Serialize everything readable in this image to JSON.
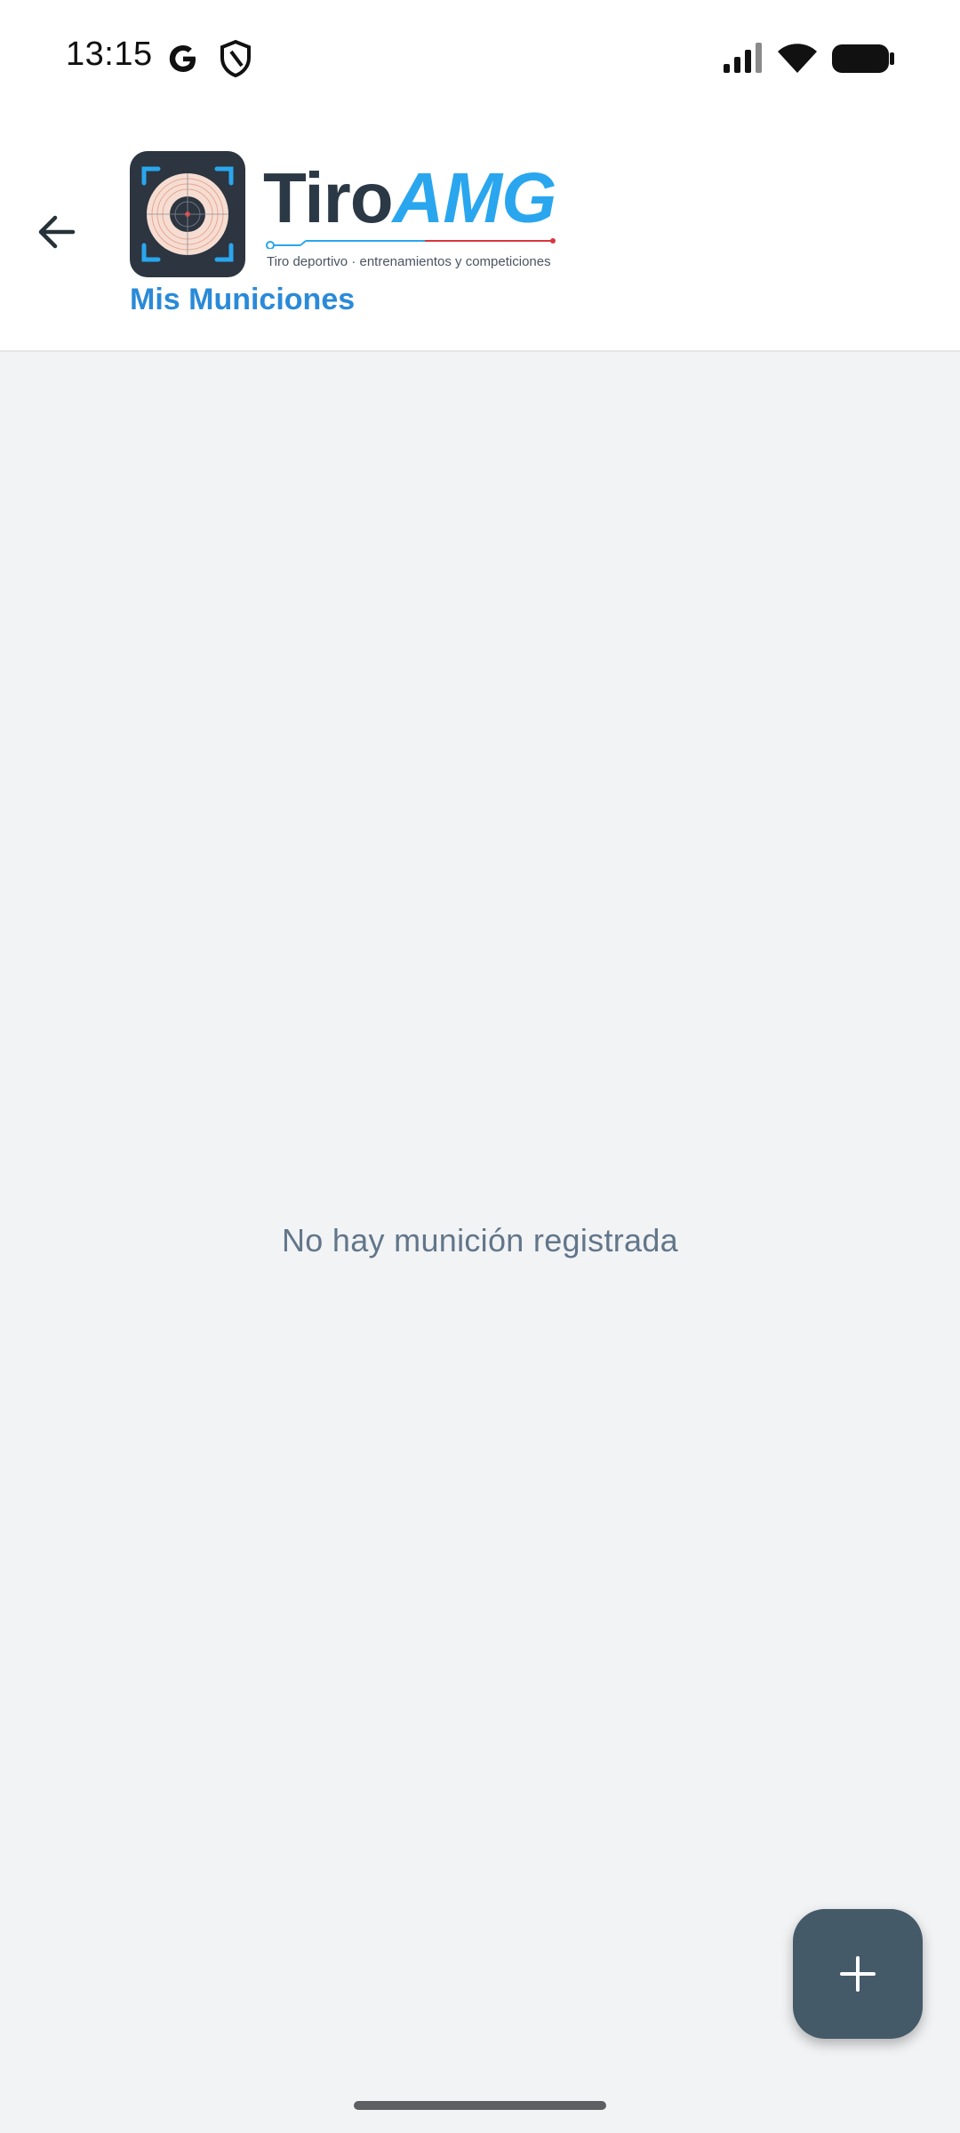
{
  "status_bar": {
    "time": "13:15",
    "icons": [
      "google-icon",
      "shield-icon",
      "signal-icon",
      "wifi-icon",
      "battery-icon"
    ]
  },
  "app_bar": {
    "back_icon": "arrow-back-icon",
    "logo": {
      "name_part1": "Tiro",
      "name_part2": "AMG",
      "tagline": "Tiro deportivo · entrenamientos y competiciones"
    },
    "title": "Mis Municiones"
  },
  "content": {
    "empty_message": "No hay munición registrada"
  },
  "fab": {
    "icon": "plus-icon"
  },
  "colors": {
    "accent": "#2a8ad8",
    "logo_blue": "#2aa6ee",
    "logo_dark": "#2b3845",
    "fab": "#455a68",
    "background": "#f2f3f5",
    "empty_text": "#62768a"
  }
}
